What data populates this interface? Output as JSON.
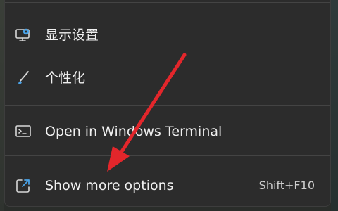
{
  "menu": {
    "items": [
      {
        "label": "显示设置",
        "icon": "display-settings-icon"
      },
      {
        "label": "个性化",
        "icon": "pen-brush-icon"
      },
      {
        "label": "Open in Windows Terminal",
        "icon": "terminal-icon"
      },
      {
        "label": "Show more options",
        "shortcut": "Shift+F10",
        "icon": "show-more-options-icon"
      }
    ]
  },
  "annotation": {
    "color": "#e3262b",
    "icon": "red-arrow-annotation"
  },
  "colors": {
    "menu_bg": "#2c2c2c",
    "text": "#f0f0f0",
    "icon_accent": "#4aa3e8"
  }
}
